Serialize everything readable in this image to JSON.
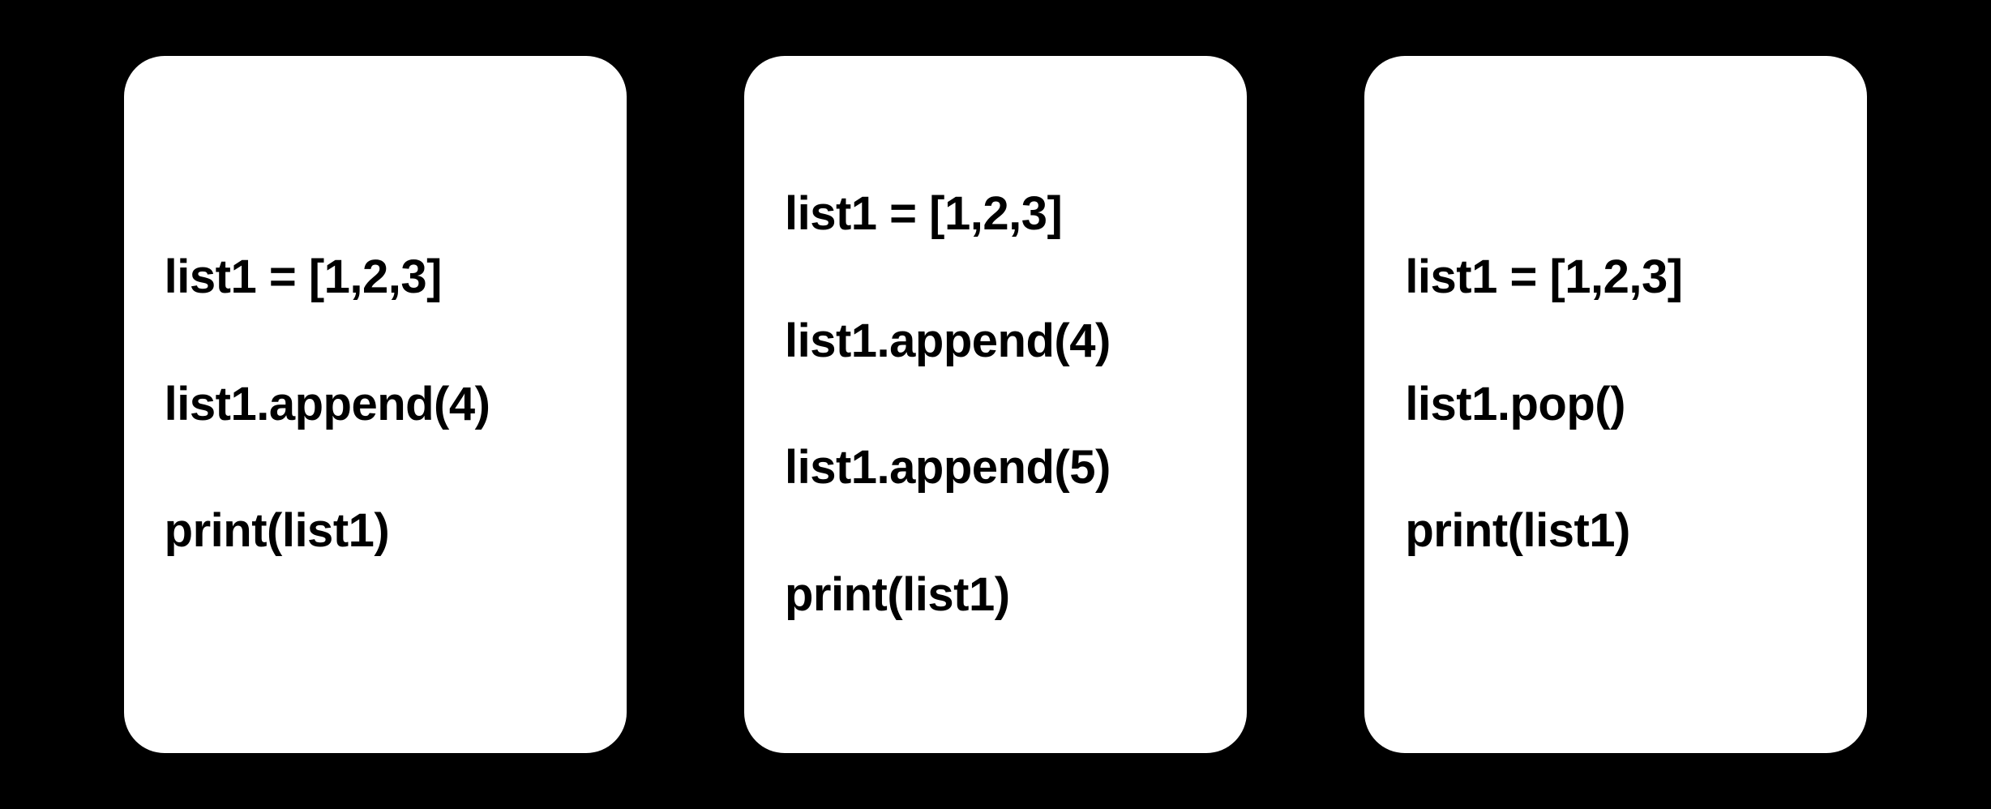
{
  "cards": [
    {
      "lines": [
        "list1 = [1,2,3]",
        "list1.append(4)",
        "print(list1)"
      ]
    },
    {
      "lines": [
        "list1 = [1,2,3]",
        "list1.append(4)",
        "list1.append(5)",
        "print(list1)"
      ]
    },
    {
      "lines": [
        "list1 = [1,2,3]",
        "list1.pop()",
        "print(list1)"
      ]
    }
  ]
}
